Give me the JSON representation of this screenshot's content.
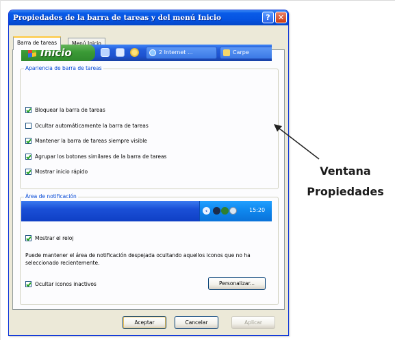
{
  "window": {
    "title": "Propiedades de la barra de tareas y del menú Inicio",
    "help_label": "?",
    "close_label": "✕"
  },
  "tabs": [
    {
      "label": "Barra de tareas",
      "active": true
    },
    {
      "label": "Menú Inicio",
      "active": false
    }
  ],
  "appearance": {
    "group_label": "Apariencia de barra de tareas",
    "preview": {
      "start_label": "Inicio",
      "task_buttons": [
        "2 Internet ...",
        "Carpe"
      ]
    },
    "options": [
      {
        "label": "Bloquear la barra de tareas",
        "checked": true
      },
      {
        "label": "Ocultar automáticamente la barra de tareas",
        "checked": false
      },
      {
        "label": "Mantener la barra de tareas siempre visible",
        "checked": true
      },
      {
        "label": "Agrupar los botones similares de la barra de tareas",
        "checked": true
      },
      {
        "label": "Mostrar inicio rápido",
        "checked": true
      }
    ]
  },
  "notification": {
    "group_label": "Área de notificación",
    "clock_time": "15:20",
    "chevron": "‹",
    "show_clock": {
      "label": "Mostrar el reloj",
      "checked": true
    },
    "description": "Puede mantener el área de notificación despejada ocultando aquellos iconos que no ha seleccionado recientemente.",
    "hide_inactive": {
      "label": "Ocultar iconos inactivos",
      "checked": true
    },
    "customize_label": "Personalizar..."
  },
  "footer": {
    "accept_label": "Aceptar",
    "cancel_label": "Cancelar",
    "apply_label": "Aplicar"
  },
  "annotation": {
    "line1": "Ventana",
    "line2": "Propiedades"
  },
  "colors": {
    "title_bar": "#0553e1",
    "group_label": "#0046d5",
    "start_button": "#3b9a36",
    "taskbar": "#245edb"
  }
}
